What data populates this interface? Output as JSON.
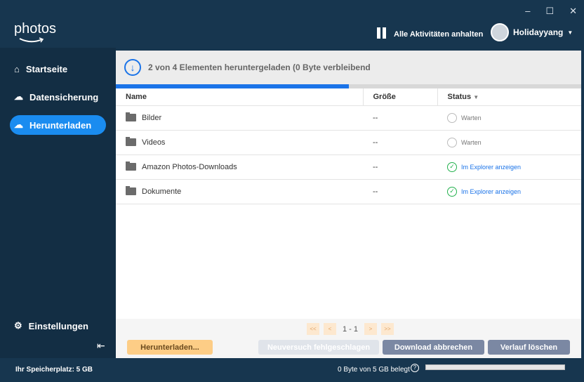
{
  "window": {
    "minimize": "–",
    "maximize": "☐",
    "close": "✕"
  },
  "logo": "photos",
  "header": {
    "pause_label": "Alle Aktivitäten anhalten",
    "username": "Holidayyang"
  },
  "sidebar": {
    "items": [
      {
        "label": "Startseite"
      },
      {
        "label": "Datensicherung"
      },
      {
        "label": "Herunterladen"
      }
    ],
    "settings": "Einstellungen",
    "collapse": "⇤"
  },
  "banner": {
    "text": "2 von 4 Elementen heruntergeladen (0 Byte verbleibend",
    "progress_percent": 50
  },
  "table": {
    "headers": [
      "Name",
      "Größe",
      "Status"
    ],
    "rows": [
      {
        "name": "Bilder",
        "size": "--",
        "status": "Warten",
        "done": false
      },
      {
        "name": "Videos",
        "size": "--",
        "status": "Warten",
        "done": false
      },
      {
        "name": "Amazon Photos-Downloads",
        "size": "--",
        "status": "Im Explorer anzeigen",
        "done": true
      },
      {
        "name": "Dokumente",
        "size": "--",
        "status": "Im Explorer anzeigen",
        "done": true
      }
    ]
  },
  "pager": {
    "first": "<<",
    "prev": "<",
    "range": "1 - 1",
    "next": ">",
    "last": ">>"
  },
  "buttons": {
    "download": "Herunterladen...",
    "retry": "Neuversuch fehlgeschlagen",
    "cancel": "Download abbrechen",
    "clear": "Verlauf löschen"
  },
  "statusbar": {
    "storage": "Ihr Speicherplatz: 5 GB",
    "used": "0 Byte von 5 GB belegt",
    "help": "?",
    "used_percent": 0
  },
  "colors": {
    "accent": "#1a73e8",
    "bg": "#17364f"
  }
}
